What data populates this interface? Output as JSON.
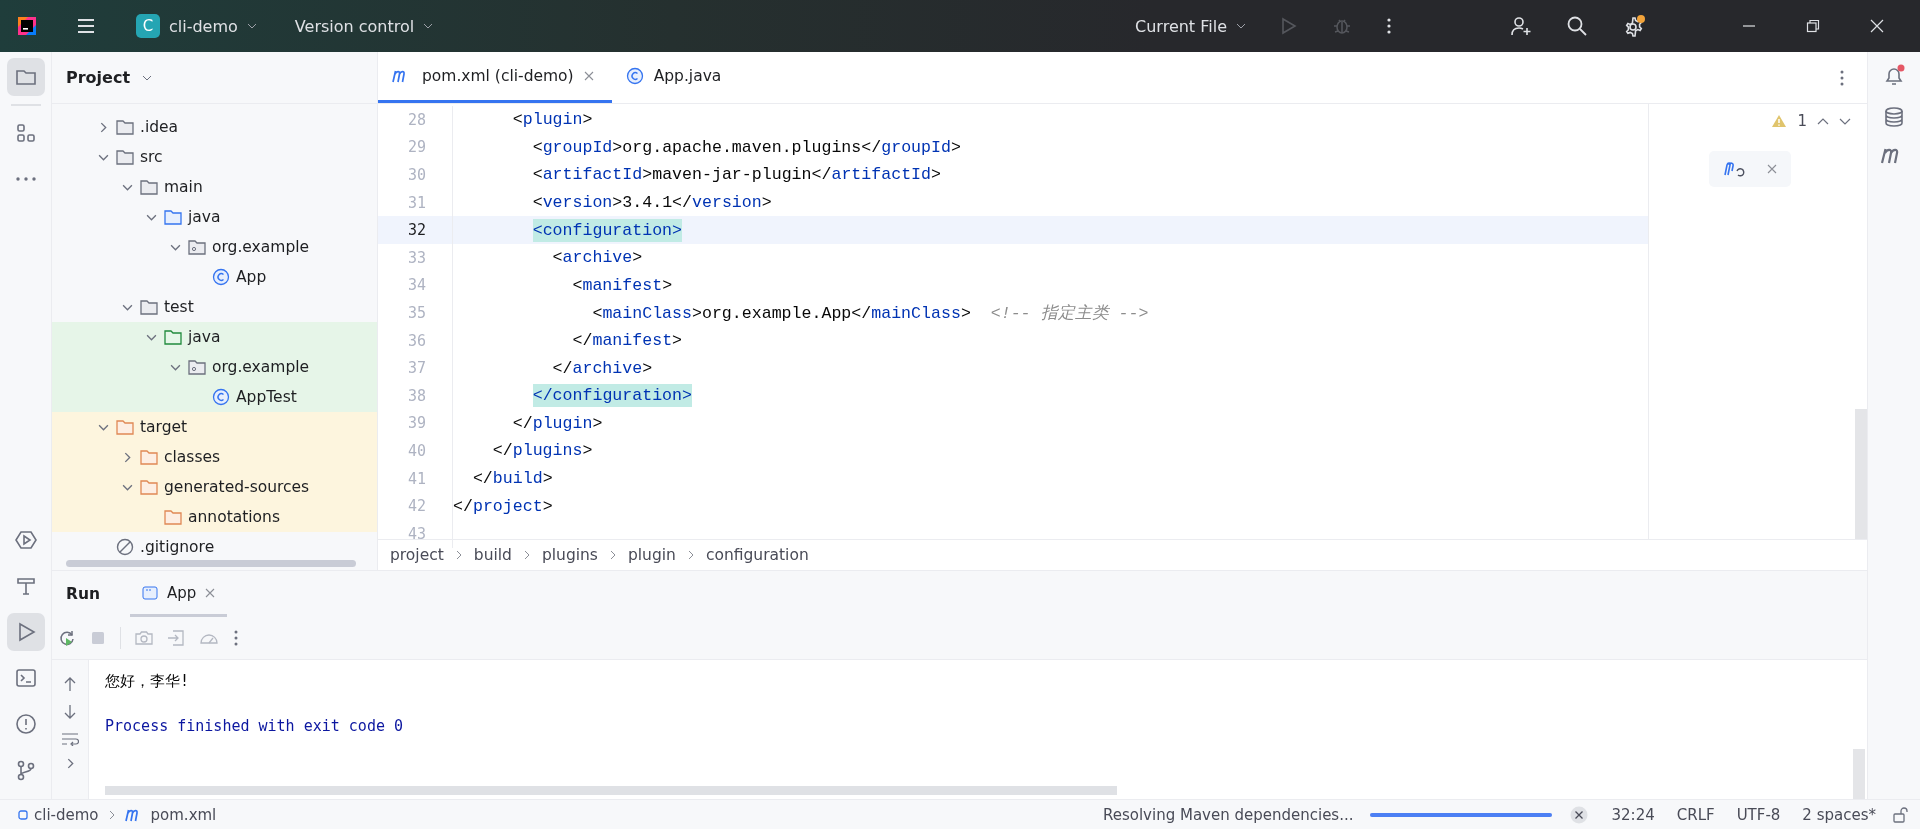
{
  "title_bar": {
    "project_badge": "C",
    "project_name": "cli-demo",
    "vcs_menu": "Version control",
    "run_config": "Current File",
    "run_enabled": false,
    "settings_badge": true
  },
  "left_toolbar": {
    "top": [
      {
        "kind": "project",
        "selected": true
      },
      {
        "kind": "structure",
        "selected": false
      },
      {
        "kind": "more",
        "selected": false
      }
    ],
    "bottom": [
      {
        "kind": "services",
        "selected": false
      },
      {
        "kind": "build",
        "selected": false
      },
      {
        "kind": "run",
        "selected": true
      },
      {
        "kind": "terminal",
        "selected": false
      },
      {
        "kind": "problems",
        "selected": false
      },
      {
        "kind": "git",
        "selected": false
      }
    ]
  },
  "project_panel": {
    "title": "Project",
    "tree": [
      {
        "label": ".idea",
        "kind": "folder",
        "expanded": false
      },
      {
        "label": "src",
        "kind": "folder",
        "expanded": true,
        "children": [
          {
            "label": "main",
            "kind": "folder",
            "expanded": true,
            "children": [
              {
                "label": "java",
                "kind": "source-folder",
                "expanded": true,
                "children": [
                  {
                    "label": "org.example",
                    "kind": "package",
                    "expanded": true,
                    "children": [
                      {
                        "label": "App",
                        "kind": "class"
                      }
                    ]
                  }
                ]
              }
            ]
          },
          {
            "label": "test",
            "kind": "folder",
            "expanded": true,
            "children": [
              {
                "label": "java",
                "kind": "test-folder",
                "expanded": true,
                "children": [
                  {
                    "label": "org.example",
                    "kind": "package",
                    "expanded": true,
                    "children": [
                      {
                        "label": "AppTest",
                        "kind": "class"
                      }
                    ]
                  }
                ]
              }
            ]
          }
        ]
      },
      {
        "label": "target",
        "kind": "excluded-folder",
        "expanded": true,
        "children": [
          {
            "label": "classes",
            "kind": "excluded-folder",
            "expanded": false
          },
          {
            "label": "generated-sources",
            "kind": "excluded-folder",
            "expanded": true,
            "children": [
              {
                "label": "annotations",
                "kind": "excluded-folder"
              }
            ]
          }
        ]
      },
      {
        "label": ".gitignore",
        "kind": "ignore"
      }
    ]
  },
  "editor": {
    "tabs": [
      {
        "label": "pom.xml (cli-demo)",
        "kind": "maven",
        "selected": true
      },
      {
        "label": "App.java",
        "kind": "class",
        "selected": false
      }
    ],
    "warnings": "1",
    "lines": [
      {
        "number": "28",
        "current": false,
        "tokens": [
          {
            "kind": "plain",
            "text": "      <"
          },
          {
            "kind": "tag",
            "text": "plugin"
          },
          {
            "kind": "plain",
            "text": ">"
          }
        ]
      },
      {
        "number": "29",
        "current": false,
        "tokens": [
          {
            "kind": "plain",
            "text": "        <"
          },
          {
            "kind": "tag",
            "text": "groupId"
          },
          {
            "kind": "plain",
            "text": ">org.apache.maven.plugins</"
          },
          {
            "kind": "tag",
            "text": "groupId"
          },
          {
            "kind": "plain",
            "text": ">"
          }
        ]
      },
      {
        "number": "30",
        "current": false,
        "tokens": [
          {
            "kind": "plain",
            "text": "        <"
          },
          {
            "kind": "tag",
            "text": "artifactId"
          },
          {
            "kind": "plain",
            "text": ">maven-jar-plugin</"
          },
          {
            "kind": "tag",
            "text": "artifactId"
          },
          {
            "kind": "plain",
            "text": ">"
          }
        ]
      },
      {
        "number": "31",
        "current": false,
        "tokens": [
          {
            "kind": "plain",
            "text": "        <"
          },
          {
            "kind": "tag",
            "text": "version"
          },
          {
            "kind": "plain",
            "text": ">3.4.1</"
          },
          {
            "kind": "tag",
            "text": "version"
          },
          {
            "kind": "plain",
            "text": ">"
          }
        ]
      },
      {
        "number": "32",
        "current": true,
        "tokens": [
          {
            "kind": "match",
            "text": "        <configuration>"
          }
        ]
      },
      {
        "number": "33",
        "current": false,
        "tokens": [
          {
            "kind": "plain",
            "text": "          <"
          },
          {
            "kind": "tag",
            "text": "archive"
          },
          {
            "kind": "plain",
            "text": ">"
          }
        ]
      },
      {
        "number": "34",
        "current": false,
        "tokens": [
          {
            "kind": "plain",
            "text": "            <"
          },
          {
            "kind": "tag",
            "text": "manifest"
          },
          {
            "kind": "plain",
            "text": ">"
          }
        ]
      },
      {
        "number": "35",
        "current": false,
        "tokens": [
          {
            "kind": "plain",
            "text": "              <"
          },
          {
            "kind": "tag",
            "text": "mainClass"
          },
          {
            "kind": "plain",
            "text": ">org.example.App</"
          },
          {
            "kind": "tag",
            "text": "mainClass"
          },
          {
            "kind": "plain",
            "text": ">  "
          },
          {
            "kind": "comment",
            "text": "<!-- 指定主类 -->"
          }
        ]
      },
      {
        "number": "36",
        "current": false,
        "tokens": [
          {
            "kind": "plain",
            "text": "            </"
          },
          {
            "kind": "tag",
            "text": "manifest"
          },
          {
            "kind": "plain",
            "text": ">"
          }
        ]
      },
      {
        "number": "37",
        "current": false,
        "tokens": [
          {
            "kind": "plain",
            "text": "          </"
          },
          {
            "kind": "tag",
            "text": "archive"
          },
          {
            "kind": "plain",
            "text": ">"
          }
        ]
      },
      {
        "number": "38",
        "current": false,
        "tokens": [
          {
            "kind": "match",
            "text": "        </configuration>"
          }
        ]
      },
      {
        "number": "39",
        "current": false,
        "tokens": [
          {
            "kind": "plain",
            "text": "      </"
          },
          {
            "kind": "tag",
            "text": "plugin"
          },
          {
            "kind": "plain",
            "text": ">"
          }
        ]
      },
      {
        "number": "40",
        "current": false,
        "tokens": [
          {
            "kind": "plain",
            "text": "    </"
          },
          {
            "kind": "tag",
            "text": "plugins"
          },
          {
            "kind": "plain",
            "text": ">"
          }
        ]
      },
      {
        "number": "41",
        "current": false,
        "tokens": [
          {
            "kind": "plain",
            "text": "  </"
          },
          {
            "kind": "tag",
            "text": "build"
          },
          {
            "kind": "plain",
            "text": ">"
          }
        ]
      },
      {
        "number": "42",
        "current": false,
        "tokens": [
          {
            "kind": "plain",
            "text": "</"
          },
          {
            "kind": "tag",
            "text": "project"
          },
          {
            "kind": "plain",
            "text": ">"
          }
        ]
      },
      {
        "number": "43",
        "current": false
      }
    ],
    "breadcrumbs": [
      "project",
      "build",
      "plugins",
      "plugin",
      "configuration"
    ]
  },
  "right_toolbar": {
    "notifications": true
  },
  "run_panel": {
    "title": "Run",
    "tabs": [
      {
        "label": "App",
        "selected": true
      }
    ],
    "console": [
      {
        "kind": "output",
        "text": "您好，李华!"
      },
      {
        "kind": "system",
        "text": "Process finished with exit code 0"
      }
    ]
  },
  "status_bar": {
    "path": [
      {
        "kind": "project",
        "label": "cli-demo"
      },
      {
        "kind": "maven",
        "label": "pom.xml"
      }
    ],
    "task": "Resolving Maven dependencies...",
    "progress": {
      "level": 1
    },
    "items": [
      "32:24",
      "CRLF",
      "UTF-8",
      "2 spaces*"
    ]
  }
}
